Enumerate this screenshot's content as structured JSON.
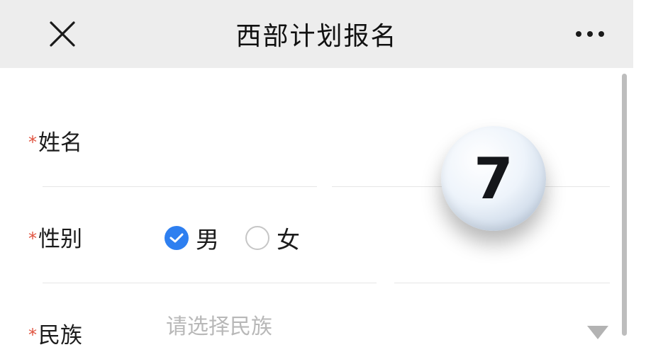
{
  "header": {
    "close_icon": "close-icon",
    "title": "西部计划报名",
    "more_icon": "more-icon"
  },
  "form": {
    "name": {
      "required_mark": "*",
      "label": "姓名",
      "value": ""
    },
    "gender": {
      "required_mark": "*",
      "label": "性别",
      "options": [
        {
          "label": "男",
          "checked": true
        },
        {
          "label": "女",
          "checked": false
        }
      ]
    },
    "ethnicity": {
      "required_mark": "*",
      "label": "民族",
      "placeholder": "请选择民族",
      "dropdown_icon": "dropdown-arrow-icon"
    }
  },
  "overlay_badge": {
    "text": "7"
  },
  "colors": {
    "header_bg": "#ededed",
    "required": "#e0533f",
    "radio_checked": "#2e7ff0",
    "placeholder": "#b8b8b8"
  }
}
